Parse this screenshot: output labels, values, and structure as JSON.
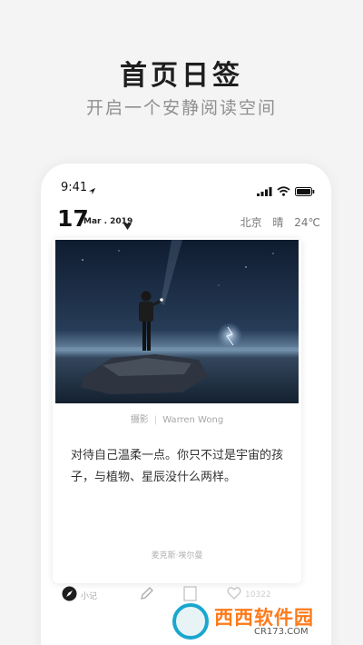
{
  "promo": {
    "title": "首页日签",
    "subtitle": "开启一个安静阅读空间"
  },
  "status_bar": {
    "time": "9:41",
    "icons": [
      "location-arrow-icon",
      "signal-icon",
      "wifi-icon",
      "battery-icon"
    ]
  },
  "date_header": {
    "day": "17",
    "month_year": "Mar . 2019",
    "city": "北京",
    "weather": "晴",
    "temperature": "24℃"
  },
  "card": {
    "photo_label": "摄影",
    "photographer": "Warren Wong",
    "quote": "对待自己温柔一点。你只不过是宇宙的孩子，与植物、星辰没什么两样。",
    "author": "麦克斯·埃尔曼"
  },
  "bottom_nav": {
    "note_label": "小记",
    "like_count": "10322"
  },
  "watermark": {
    "brand": "西西软件园",
    "url": "CR173.COM"
  },
  "colors": {
    "accent_blue": "#19a7cf",
    "watermark_orange": "#ff7a1a"
  }
}
